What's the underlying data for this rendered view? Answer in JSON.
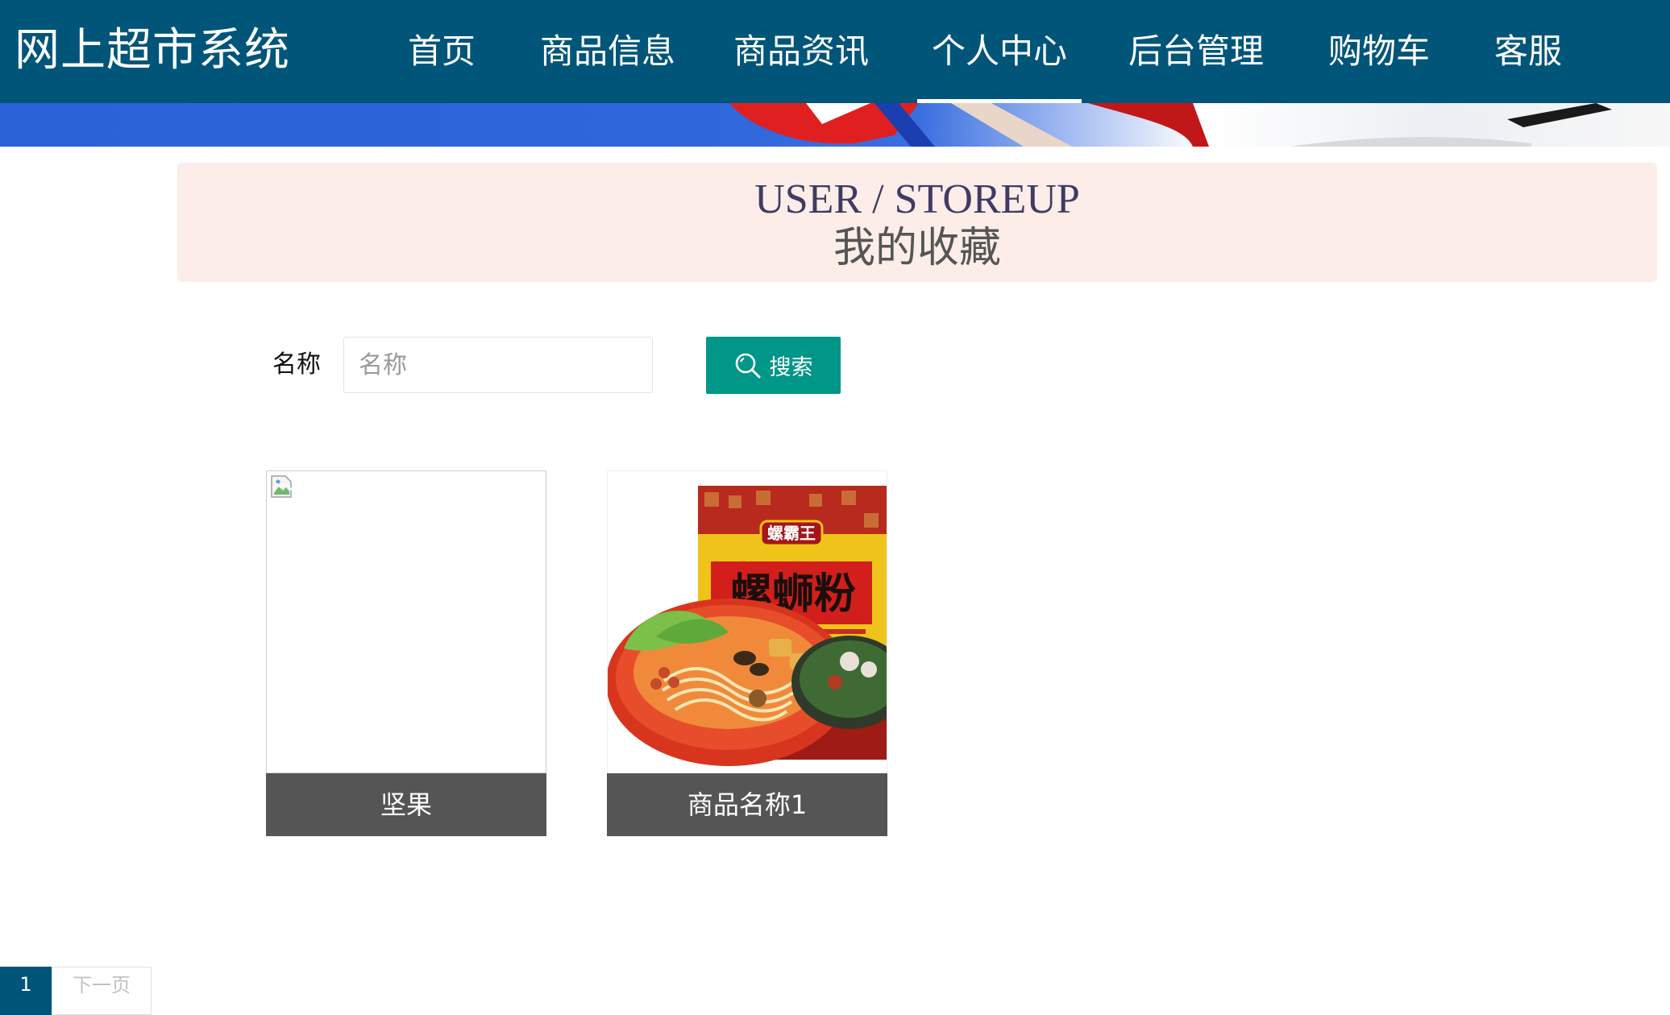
{
  "app": {
    "title": "网上超市系统"
  },
  "nav": {
    "items": [
      {
        "label": "首页"
      },
      {
        "label": "商品信息"
      },
      {
        "label": "商品资讯"
      },
      {
        "label": "个人中心",
        "active": true
      },
      {
        "label": "后台管理"
      },
      {
        "label": "购物车"
      },
      {
        "label": "客服"
      }
    ]
  },
  "page": {
    "title_en": "USER / STOREUP",
    "title_cn": "我的收藏"
  },
  "search": {
    "label": "名称",
    "value": "",
    "placeholder": "名称",
    "button_label": "搜索",
    "button_icon": "search-icon"
  },
  "favorites": [
    {
      "name": "坚果",
      "image": "broken-image"
    },
    {
      "name": "商品名称1",
      "image": "螺蛳粉 product photo",
      "package_brand": "螺霸王",
      "package_title": "螺蛳粉"
    }
  ],
  "pagination": {
    "current": "1",
    "next_label": "下一页"
  },
  "colors": {
    "nav_bg": "#005579",
    "title_bar_bg": "#fcede8",
    "search_button": "#009688",
    "card_label_bg": "#555555",
    "pager_active": "#005579"
  }
}
